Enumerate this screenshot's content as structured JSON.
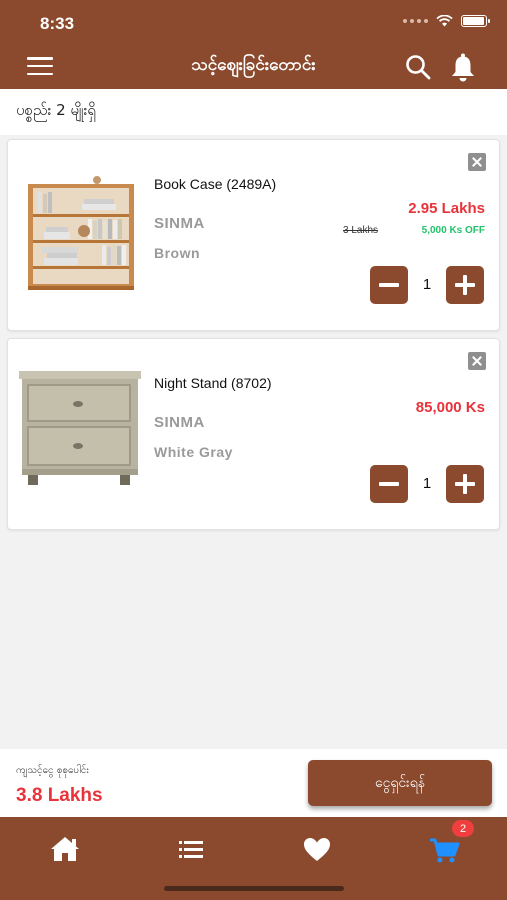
{
  "status_bar": {
    "time": "8:33"
  },
  "header": {
    "title": "သင့်စျေးခြင်းတောင်း"
  },
  "cart_summary": {
    "items_count_label": "ပစ္စည်း 2 မျိုးရှိ"
  },
  "cart_items": [
    {
      "name": "Book Case (2489A)",
      "brand": "SINMA",
      "color": "Brown",
      "price": "2.95 Lakhs",
      "old_price": "3 Lakhs",
      "discount": "5,000 Ks OFF",
      "quantity": "1"
    },
    {
      "name": "Night Stand (8702)",
      "brand": "SINMA",
      "color": "White Gray",
      "price": "85,000 Ks",
      "quantity": "1"
    }
  ],
  "footer": {
    "total_label": "ကျသင့်ငွေ စုစုပေါင်း",
    "total_value": "3.8 Lakhs",
    "checkout_label": "ငွေရှင်းရန်"
  },
  "bottom_nav": {
    "items": [
      "home-icon",
      "list-icon",
      "heart-icon",
      "cart-icon"
    ],
    "cart_badge": "2"
  },
  "colors": {
    "primary": "#8b4a2e",
    "price_red": "#e8333a",
    "discount_green": "#23c26a",
    "active_nav": "#1e90ff"
  }
}
